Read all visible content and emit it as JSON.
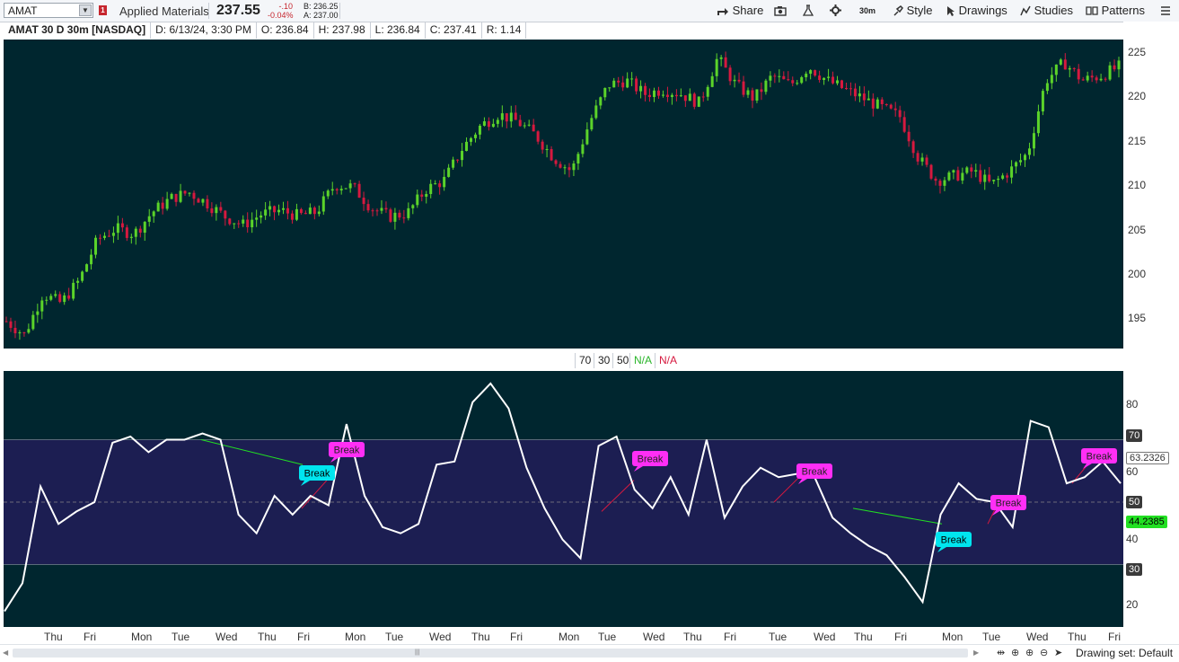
{
  "header": {
    "symbol": "AMAT",
    "flag": "1",
    "company": "Applied Materials",
    "last": "237.55",
    "change": "-.10",
    "change_pct": "-0.04%",
    "bid": "B: 236.25",
    "ask": "A: 237.00",
    "buttons": {
      "share": "Share",
      "timeframe": "30m",
      "style": "Style",
      "drawings": "Drawings",
      "studies": "Studies",
      "patterns": "Patterns"
    }
  },
  "info": {
    "symbol_label": "AMAT 30 D 30m [NASDAQ]",
    "date": "D: 6/13/24, 3:30 PM",
    "open": "O: 236.84",
    "high": "H: 237.98",
    "low": "L: 236.84",
    "close": "C: 237.41",
    "range": "R: 1.14"
  },
  "price_axis": [
    "225",
    "220",
    "215",
    "210",
    "205",
    "200",
    "195"
  ],
  "indicator": {
    "values": [
      "70",
      "30",
      "50"
    ],
    "na_green": "N/A",
    "na_red": "N/A",
    "axis": [
      "80",
      "60",
      "40",
      "20"
    ],
    "badges": {
      "ob": "70",
      "os": "30",
      "mid": "50",
      "current": "63.2326",
      "alt": "44.2385"
    },
    "break_label": "Break"
  },
  "x_axis": [
    "Thu",
    "Fri",
    "Mon",
    "Tue",
    "Wed",
    "Thu",
    "Fri",
    "Mon",
    "Tue",
    "Wed",
    "Thu",
    "Fri",
    "Mon",
    "Tue",
    "Wed",
    "Thu",
    "Fri",
    "Tue",
    "Wed",
    "Thu",
    "Fri",
    "Mon",
    "Tue",
    "Wed",
    "Thu",
    "Fri"
  ],
  "footer": {
    "drawing_set": "Drawing set: Default"
  },
  "colors": {
    "background": "#00262f",
    "up": "#5bd32a",
    "down": "#d6193f",
    "cyan": "#00e5ef",
    "magenta": "#ff2ef5",
    "band": "#1c1e52"
  },
  "chart_data": [
    {
      "type": "candlestick",
      "series": [
        {
          "name": "AMAT 30 D 30m",
          "values": [
            195.0,
            193.5,
            198.0,
            197.0,
            199.5,
            204.0,
            205.2,
            204.6,
            207.0,
            208.5,
            209.2,
            208.0,
            206.5,
            205.6,
            206.8,
            207.2,
            206.6,
            207.0,
            210.0,
            209.8,
            207.5,
            206.5,
            206.9,
            209.5,
            210.5,
            214.0,
            216.5,
            217.8,
            217.0,
            215.5,
            213.0,
            211.5,
            217.0,
            221.0,
            221.5,
            220.0,
            220.5,
            220.0,
            219.0,
            224.0,
            221.0,
            219.5,
            222.0,
            221.0,
            223.0,
            221.5,
            220.5,
            219.5,
            218.5,
            217.5,
            213.0,
            210.5,
            211.0,
            211.5,
            210.0,
            211.5,
            213.5,
            221.5,
            223.5,
            221.5,
            222.0,
            223.0
          ]
        }
      ],
      "ylim": [
        192,
        226
      ]
    },
    {
      "type": "line",
      "series": [
        {
          "name": "",
          "values": [
            15,
            24,
            55,
            43,
            47,
            50,
            69,
            71,
            66,
            70,
            70,
            72,
            70,
            46,
            40,
            52,
            46,
            52,
            49,
            75,
            52,
            42,
            40,
            43,
            62,
            63,
            82,
            88,
            80,
            61,
            48,
            38,
            32,
            68,
            71,
            54,
            48,
            58,
            46,
            70,
            45,
            55,
            61,
            58,
            59,
            58,
            45,
            40,
            36,
            33,
            26,
            18,
            46,
            56,
            51,
            50,
            42,
            76,
            74,
            56,
            58,
            63,
            56
          ]
        }
      ],
      "ylim": [
        10,
        92
      ]
    }
  ]
}
